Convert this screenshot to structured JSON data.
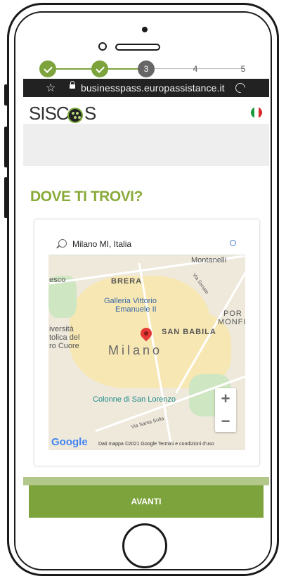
{
  "browser": {
    "url": "businesspass.europassistance.it",
    "star_icon": "star-icon",
    "lock_icon": "lock-icon",
    "reload_icon": "reload-icon"
  },
  "header": {
    "logo": "SISCOS",
    "logo_left": "SISC",
    "logo_right": "S",
    "flag_colors": [
      "#1a9a3c",
      "#ffffff",
      "#d72b2b"
    ]
  },
  "stepper": {
    "steps": [
      {
        "label": "1",
        "state": "done"
      },
      {
        "label": "2",
        "state": "done"
      },
      {
        "label": "3",
        "state": "current"
      },
      {
        "label": "4",
        "state": "future"
      },
      {
        "label": "5",
        "state": "future"
      }
    ],
    "accent": "#7da33c"
  },
  "page": {
    "title": "DOVE TI TROVI?"
  },
  "map": {
    "search_value": "Milano MI, Italia",
    "labels": {
      "montanelli": "Montanelli",
      "esco": "esco",
      "brera": "BRERA",
      "galleria1": "Galleria Vittorio",
      "galleria2": "Emanuele II",
      "universita1": "iversità",
      "universita2": "tolica del",
      "universita3": "ro Cuore",
      "san_babila": "SAN BABILA",
      "por": "POR",
      "monf": "MONFI",
      "milano": "Milano",
      "colonne": "Colonne di San Lorenzo",
      "via_santa_sofia": "Via Santa Sofia",
      "via_senato": "Via Senato"
    },
    "zoom_in": "+",
    "zoom_out": "−",
    "google": "Google",
    "attribution": "Dati mappa ©2021 Google   Termini e condizioni d'uso"
  },
  "footer": {
    "button_label": "AVANTI"
  }
}
